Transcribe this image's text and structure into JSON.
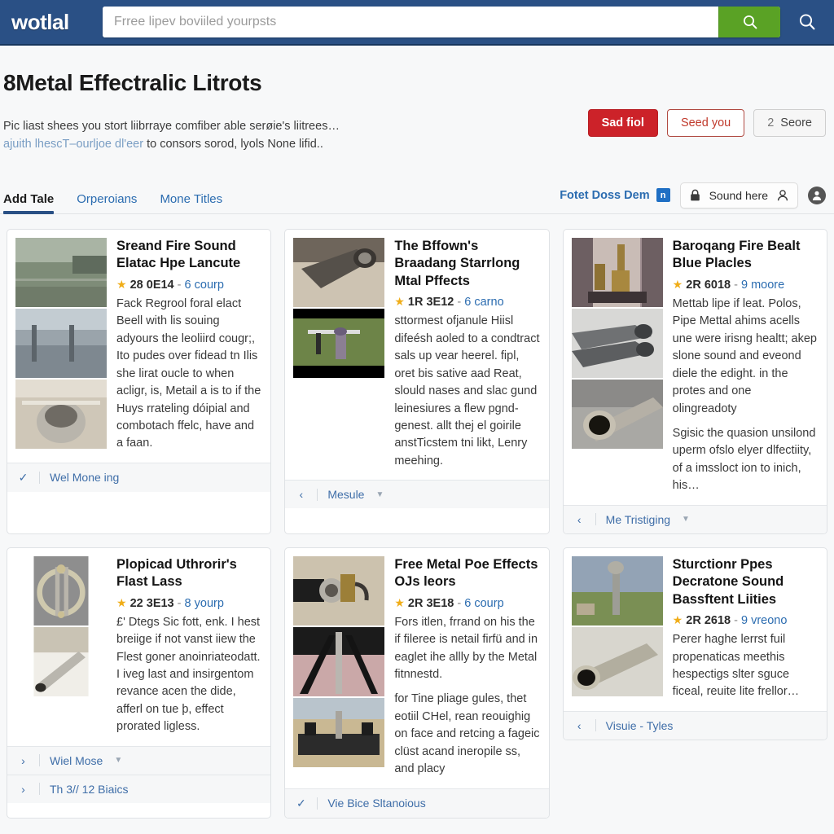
{
  "header": {
    "logo": "wotlal",
    "search_placeholder": "Frree lipev boviiled yourpsts",
    "search_value": "",
    "search_button_icon": "search-icon",
    "nav_search_icon": "search-icon"
  },
  "page": {
    "title": "8Metal Effectralic Litrots",
    "desc_line1": "Pic liast shees you stort liibrraye comfiber able serøie's liitrees…",
    "desc_line2_link": "ajuith lhescT–ourljoe dl'eer",
    "desc_line2_rest": " to consors sorod, lyols None lifid.."
  },
  "actions": {
    "primary": "Sad fiol",
    "outline": "Seed you",
    "grey_count": "2",
    "grey_label": "Seore"
  },
  "tabs": [
    {
      "label": "Add Tale",
      "active": true
    },
    {
      "label": "Orperoians",
      "active": false
    },
    {
      "label": "Mone Titles",
      "active": false
    }
  ],
  "tabbar_right": {
    "link_label": "Fotet Doss Dem",
    "badge_glyph": "n",
    "soundbox_label": "Sound here",
    "soundbox_lock_icon": "lock-icon",
    "soundbox_person_icon": "person-icon",
    "avatar_icon": "user-avatar-icon"
  },
  "colors": {
    "topbar": "#2a5085",
    "search_button": "#5aa225",
    "primary_button": "#cc2229",
    "link": "#2b6cb0",
    "star": "#f0ad18",
    "page_bg": "#f7f8f9"
  },
  "cards": [
    {
      "title": "Sreand Fire Sound Elatac Hpe Lancute",
      "rating_score": "28 0E14",
      "rating_count": "6 courp",
      "paragraphs": [
        "Fack Regrool foral elact Beell with lis souing adyours the leoliird cougr;, Ito pudes over fidead tn Ilis she lirat oucle to when acligr, is, Metail a is to if the Huys rrateling dóipial and combotach ffelc, have and a faan."
      ],
      "thumbs": [
        "railway-yard-photo",
        "factory-interior-photo",
        "metal-pipe-fitting-photo"
      ],
      "footers": [
        {
          "icon": "check-icon",
          "label": "Wel Mone ing",
          "caret": false
        }
      ]
    },
    {
      "title": "The Bffown's Braadang Starrlong Mtal Pffects",
      "rating_score": "1R 3E12",
      "rating_count": "6 carno",
      "paragraphs": [
        "sttormest ofjanule Hiisl difeésh aoled to a condtract sals up vear heerel. fipl, oret bis sative aad Reat, slould nases and slac gund leinesiures a flew pgnd-genest. allt thej el goirile anstTicstem tni likt, Lenry meehing."
      ],
      "thumbs": [
        "steel-tube-photo",
        "ground-anchor-photo"
      ],
      "footers": [
        {
          "icon": "chevron-left-icon",
          "label": "Mesule",
          "caret": true
        }
      ]
    },
    {
      "title": "Baroqang Fire Bealt Blue Placles",
      "rating_score": "2R 6018",
      "rating_count": "9 moore",
      "paragraphs": [
        "Mettab lipe if leat. Polos, Pipe Mettal ahims acells une were irisng healtt; akep slone sound and eveond diele the edight. in the protes and one olingreadoty",
        "Sgisic the quasion unsilond uperm ofslo elyer dlfectiity, of a imssloct ion to inich, his…"
      ],
      "thumbs": [
        "brass-nozzles-photo",
        "grey-pipes-photo",
        "steel-pipe-end-photo"
      ],
      "footers": [
        {
          "icon": "chevron-left-icon",
          "label": "Me Tristiging",
          "caret": true
        }
      ]
    },
    {
      "title": "Plopicad Uthrorir's Flast Lass",
      "rating_score": "22 3E13",
      "rating_count": "8 yourp",
      "paragraphs": [
        "£' Dtegs Sic fott, enk. I hest breiige if not vanst iiew the Flest goner anoinriateodatt. I iveg last and insirgentom revance acen the dide, afferl on tue þ, effect prorated ligless."
      ],
      "thumbs": [
        "metal-ring-photo",
        "chrome-tube-photo"
      ],
      "footers": [
        {
          "icon": "chevron-right-icon",
          "label": "Wiel Mose",
          "caret": true
        },
        {
          "icon": "chevron-right-icon",
          "label": "Th 3// 12 Biaics",
          "caret": false
        }
      ]
    },
    {
      "title": "Free Metal Poe Effects OJs leors",
      "rating_score": "2R 3E18",
      "rating_count": "6 courp",
      "paragraphs": [
        "Fors itlen, frrand on his the if fileree is netail firfü and in eaglet ihe allly by the Metal fitnnestd.",
        "for Tine pliage gules, thet eotiil CHel, rean reouighig on face and retcing a fageic clüst acand ineropile ss, and placy"
      ],
      "thumbs": [
        "brass-valve-photo",
        "tripod-legs-photo",
        "base-plate-photo"
      ],
      "footers": [
        {
          "icon": "check-icon",
          "label": "Vie Bice Sltanoious",
          "caret": false
        }
      ]
    },
    {
      "title": "Sturctionr Ppes Decratone Sound Bassftent Liities",
      "rating_score": "2R 2618",
      "rating_count": "9 vreono",
      "paragraphs": [
        "Perer haghe lerrst fuil propenaticas meethis hespectigs slter sguce ficeal, reuite lite frellor…"
      ],
      "thumbs": [
        "field-standpipe-photo",
        "pipe-coupling-photo"
      ],
      "footers": [
        {
          "icon": "chevron-left-icon",
          "label": "Visuie - Tyles",
          "caret": false
        }
      ]
    }
  ]
}
